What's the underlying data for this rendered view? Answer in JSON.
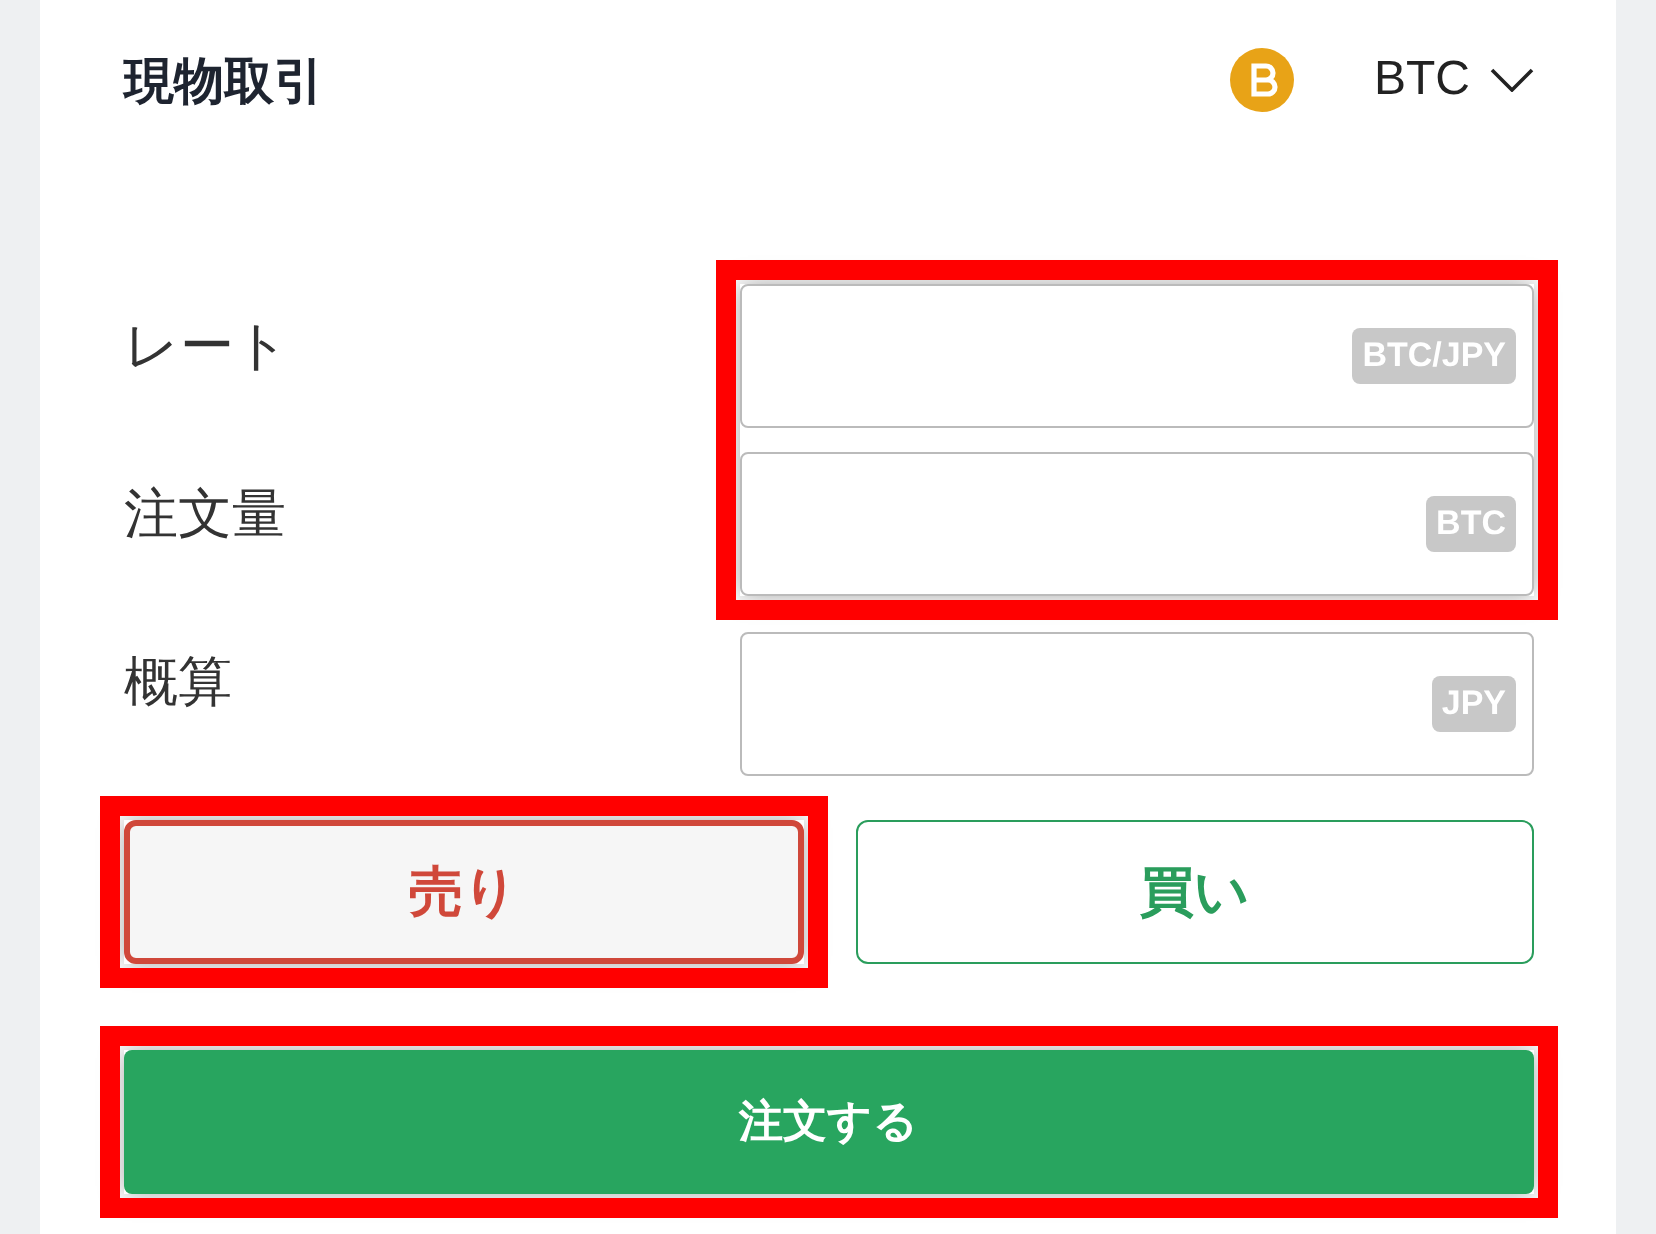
{
  "title": "現物取引",
  "currency": {
    "label": "BTC"
  },
  "fields": [
    {
      "label": "レート",
      "unit": "BTC/JPY",
      "highlighted": true
    },
    {
      "label": "注文量",
      "unit": "BTC",
      "highlighted": true
    },
    {
      "label": "概算",
      "unit": "JPY",
      "highlighted": false
    }
  ],
  "sides": [
    {
      "label": "売り",
      "kind": "sell",
      "selected": true,
      "highlighted": true
    },
    {
      "label": "買い",
      "kind": "buy",
      "selected": false,
      "highlighted": false
    }
  ],
  "submit": {
    "label": "注文する",
    "highlighted": true
  }
}
